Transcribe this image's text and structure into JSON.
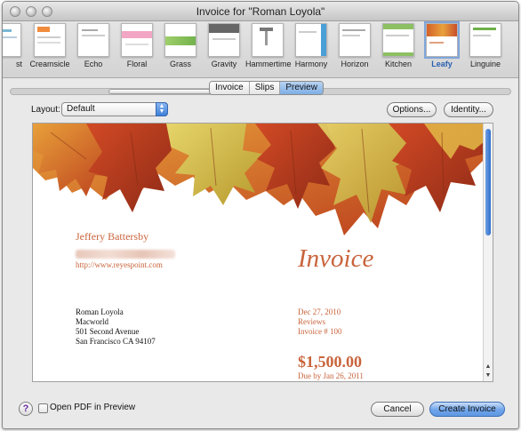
{
  "window": {
    "title": "Invoice for \"Roman Loyola\""
  },
  "themes": [
    {
      "label": "st"
    },
    {
      "label": "Creamsicle"
    },
    {
      "label": "Echo"
    },
    {
      "label": "Floral"
    },
    {
      "label": "Grass"
    },
    {
      "label": "Gravity"
    },
    {
      "label": "Hammertime"
    },
    {
      "label": "Harmony"
    },
    {
      "label": "Horizon"
    },
    {
      "label": "Kitchen"
    },
    {
      "label": "Leafy",
      "selected": true
    },
    {
      "label": "Linguine"
    }
  ],
  "tabs": [
    {
      "label": "Invoice"
    },
    {
      "label": "Slips"
    },
    {
      "label": "Preview",
      "active": true
    }
  ],
  "toolbar": {
    "layout_label": "Layout:",
    "layout_value": "Default",
    "options_label": "Options...",
    "identity_label": "Identity..."
  },
  "invoice": {
    "sender_name": "Jeffery Battersby",
    "sender_url": "http://www.reyespoint.com",
    "heading": "Invoice",
    "recipient": [
      "Roman Loyola",
      "Macworld",
      "501 Second Avenue",
      "San Francisco CA 94107"
    ],
    "date": "Dec 27, 2010",
    "category": "Reviews",
    "number": "Invoice # 100",
    "amount": "$1,500.00",
    "due": "Due by Jan 26, 2011"
  },
  "footer": {
    "help_label": "?",
    "open_pdf_label": "Open PDF in Preview",
    "cancel_label": "Cancel",
    "create_label": "Create Invoice"
  },
  "colors": {
    "accent": "#c9643c",
    "selection": "#2a5fb0"
  }
}
